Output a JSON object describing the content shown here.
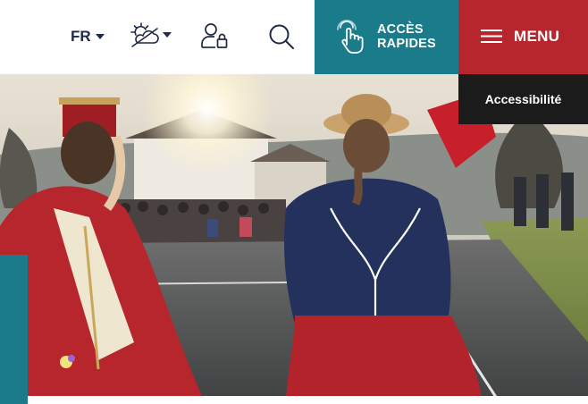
{
  "header": {
    "language": {
      "code": "FR"
    },
    "weather": {
      "icon": "weather-sun-cloud-icon"
    },
    "account": {
      "icon": "user-lock-icon"
    },
    "search": {
      "icon": "search-icon"
    },
    "quick_access": {
      "line1": "ACCÈS",
      "line2": "RAPIDES",
      "icon": "hand-pointer-icon",
      "color": "#1a7b8a"
    },
    "menu": {
      "label": "MENU",
      "icon": "hamburger-icon",
      "color": "#b8262d"
    }
  },
  "accessibility": {
    "label": "Accessibilité"
  },
  "hero": {
    "image": "Basque folk dancers in red and navy traditional costumes, backlit by sun in a village square with spectators"
  }
}
